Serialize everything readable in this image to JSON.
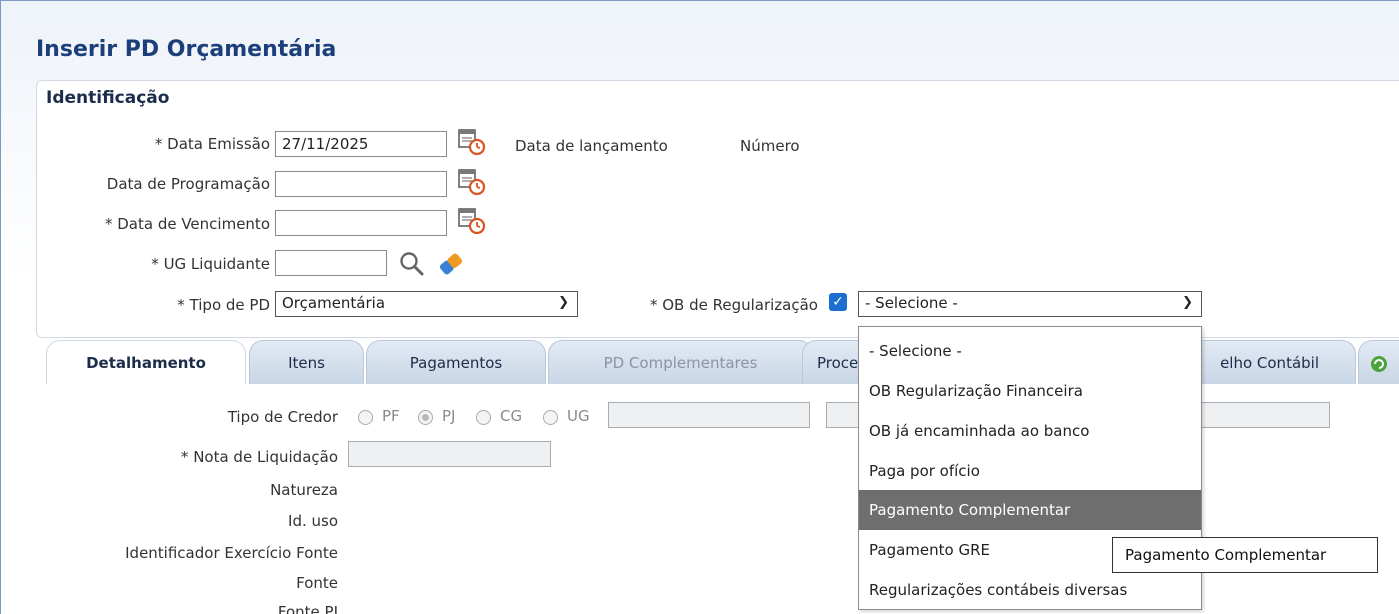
{
  "page": {
    "title": "Inserir PD Orçamentária",
    "section_title": "Identificação"
  },
  "identificacao": {
    "data_emissao_label": "* Data Emissão",
    "data_emissao_value": "27/11/2025",
    "data_lancamento_label": "Data de lançamento",
    "numero_label": "Número",
    "data_programacao_label": "Data de Programação",
    "data_programacao_value": "",
    "data_vencimento_label": "* Data de Vencimento",
    "data_vencimento_value": "",
    "ug_liquidante_label": "* UG Liquidante",
    "ug_liquidante_value": "",
    "tipo_pd_label": "* Tipo de PD",
    "tipo_pd_value": "Orçamentária",
    "ob_regularizacao_label": "* OB de Regularização",
    "ob_regularizacao_checked": true,
    "ob_select_value": "- Selecione -"
  },
  "tabs": [
    {
      "label": "Detalhamento",
      "state": "active"
    },
    {
      "label": "Itens",
      "state": "normal"
    },
    {
      "label": "Pagamentos",
      "state": "normal"
    },
    {
      "label": "PD Complementares",
      "state": "disabled"
    },
    {
      "label": "Proce",
      "state": "normal"
    },
    {
      "label": "elho Contábil",
      "state": "normal"
    }
  ],
  "detalhamento": {
    "tipo_credor_label": "Tipo de Credor",
    "credor_options": [
      "PF",
      "PJ",
      "CG",
      "UG"
    ],
    "credor_selected": "PJ",
    "nota_liquidacao_label": "* Nota de Liquidação",
    "natureza_label": "Natureza",
    "id_uso_label": "Id. uso",
    "identificador_label": "Identificador Exercício Fonte",
    "fonte_label": "Fonte",
    "fonte_pj_label": "Fonte PJ"
  },
  "dropdown": {
    "options": [
      "- Selecione -",
      "OB Regularização Financeira",
      "OB já encaminhada ao banco",
      "Paga por ofício",
      "Pagamento Complementar",
      "Pagamento GRE",
      "Regularizações contábeis diversas"
    ],
    "highlighted_index": 4
  },
  "tooltip": {
    "text": "Pagamento Complementar"
  },
  "colors": {
    "title": "#1c3f7c",
    "checkbox": "#1a6fd0",
    "highlight": "#6e6e6e"
  }
}
